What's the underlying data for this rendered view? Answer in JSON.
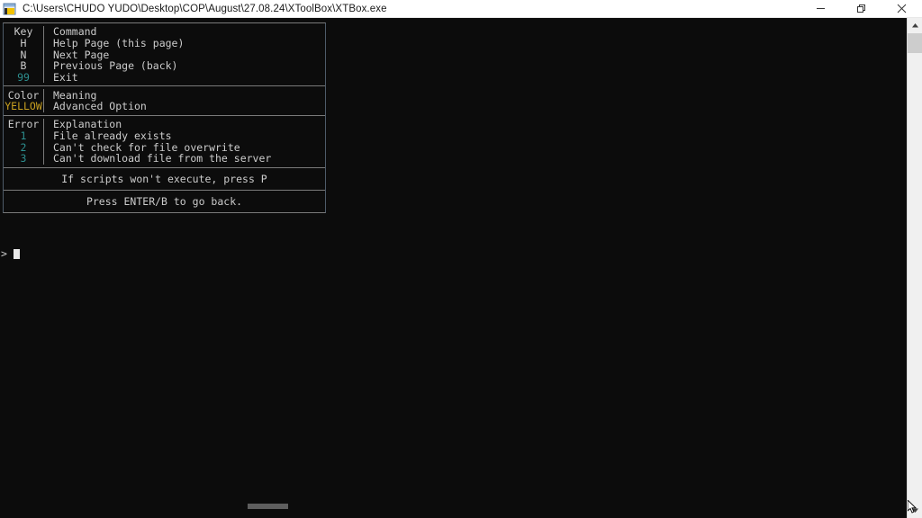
{
  "window": {
    "title": "C:\\Users\\CHUDO YUDO\\Desktop\\COP\\August\\27.08.24\\XToolBox\\XTBox.exe",
    "icon": "console-app-icon",
    "controls": {
      "minimize": "minimize-icon",
      "restore": "restore-icon",
      "close": "close-icon"
    },
    "colors": {
      "titlebar_bg": "#ffffff",
      "titlebar_text": "#1a1a1a",
      "console_bg": "#0c0c0c",
      "console_text": "#cccccc",
      "accent_teal": "#2d8f8f",
      "accent_amber": "#c8a020",
      "border_blue_gray": "#4e5b69",
      "border_gray": "#7a7a7a"
    }
  },
  "help_table": {
    "commands": {
      "header": {
        "key": "Key",
        "value": "Command"
      },
      "rows": [
        {
          "key": "H",
          "value": "Help Page (this page)",
          "key_color": "default"
        },
        {
          "key": "N",
          "value": "Next Page",
          "key_color": "default"
        },
        {
          "key": "B",
          "value": "Previous Page (back)",
          "key_color": "default"
        },
        {
          "key": "99",
          "value": "Exit",
          "key_color": "teal"
        }
      ]
    },
    "colors_legend": {
      "header": {
        "key": "Color",
        "value": "Meaning"
      },
      "rows": [
        {
          "key": "YELLOW",
          "value": "Advanced Option",
          "key_color": "amber"
        }
      ]
    },
    "errors": {
      "header": {
        "key": "Error",
        "value": "Explanation"
      },
      "rows": [
        {
          "key": "1",
          "value": "File already exists",
          "key_color": "teal"
        },
        {
          "key": "2",
          "value": "Can't check for file overwrite",
          "key_color": "teal"
        },
        {
          "key": "3",
          "value": "Can't download file from the server",
          "key_color": "teal"
        }
      ]
    },
    "footers": [
      {
        "text": "If scripts won't execute, press P"
      },
      {
        "text": "Press ENTER/B to go back."
      }
    ]
  },
  "prompt": {
    "symbol": ">",
    "input_value": ""
  },
  "scrollbars": {
    "vertical": {
      "up_icon": "chevron-up-icon",
      "down_icon": "chevron-down-icon"
    },
    "horizontal": {
      "present": true
    }
  }
}
